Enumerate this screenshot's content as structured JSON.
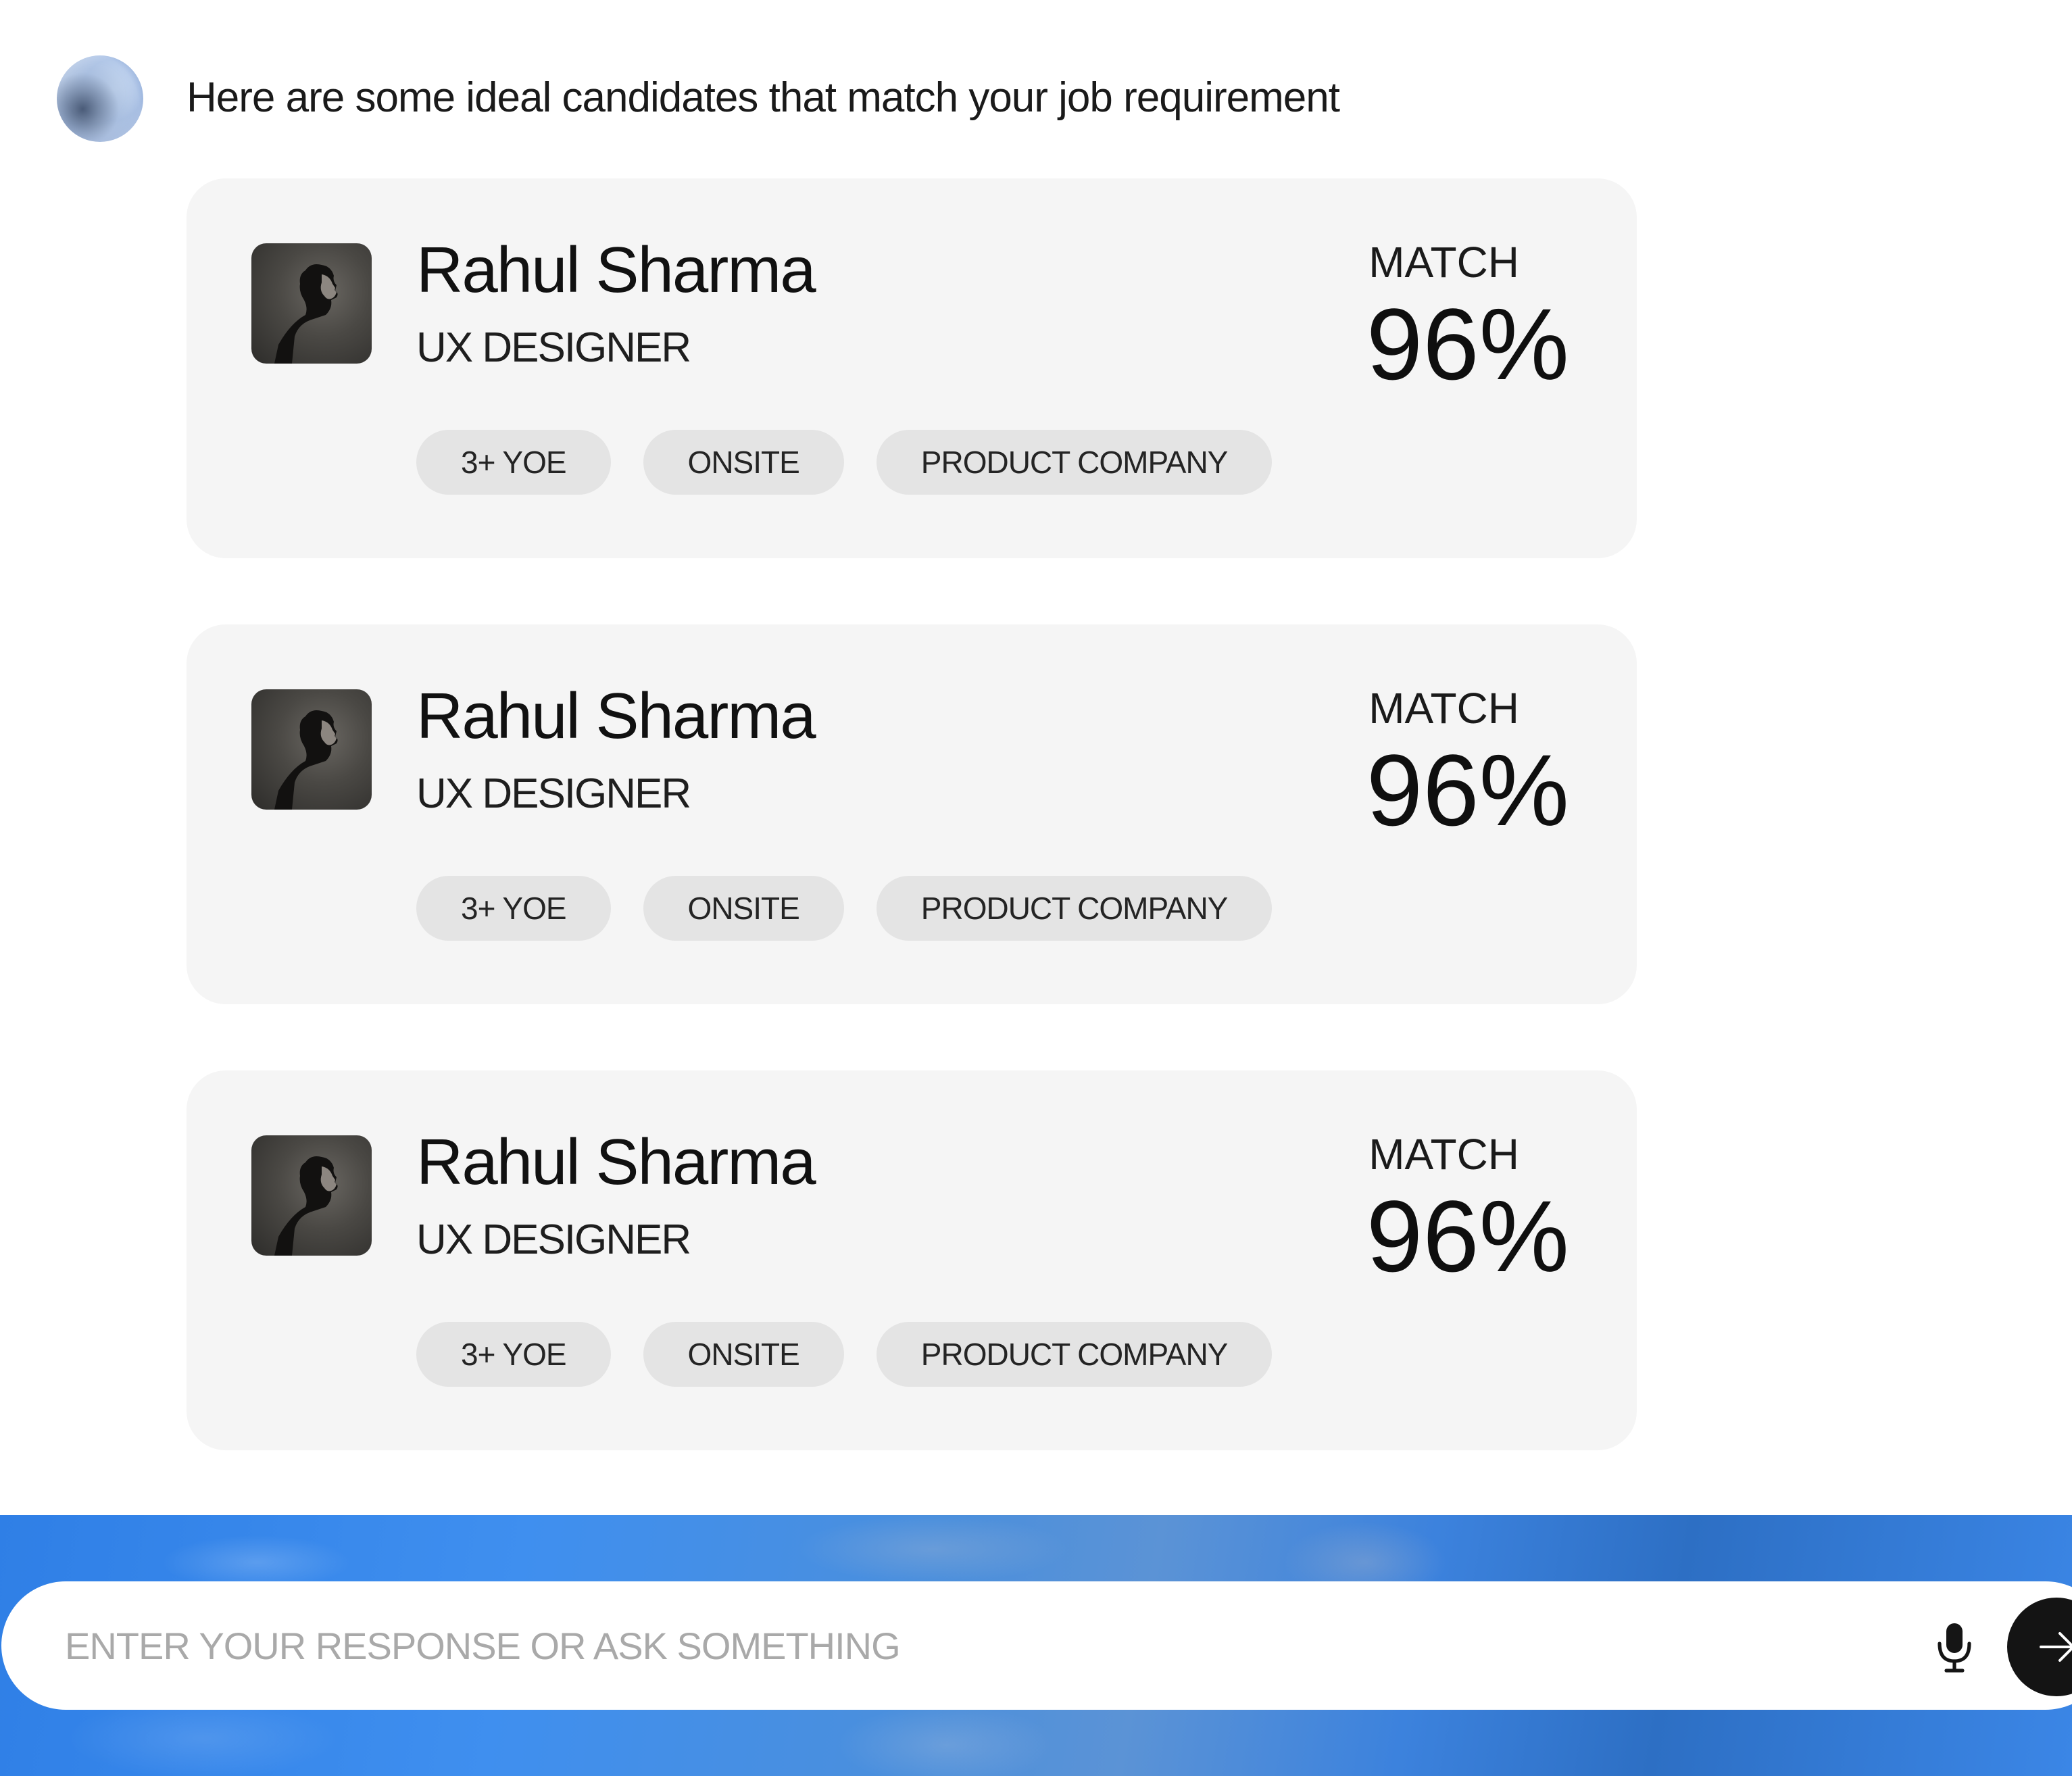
{
  "chat": {
    "intro": "Here are some ideal candidates that match your job requirement"
  },
  "candidates": [
    {
      "name": "Rahul Sharma",
      "role": "UX DESIGNER",
      "match_label": "MATCH",
      "match_value": "96%",
      "tags": [
        "3+ YOE",
        "ONSITE",
        "PRODUCT COMPANY"
      ]
    },
    {
      "name": "Rahul Sharma",
      "role": "UX DESIGNER",
      "match_label": "MATCH",
      "match_value": "96%",
      "tags": [
        "3+ YOE",
        "ONSITE",
        "PRODUCT COMPANY"
      ]
    },
    {
      "name": "Rahul Sharma",
      "role": "UX DESIGNER",
      "match_label": "MATCH",
      "match_value": "96%",
      "tags": [
        "3+ YOE",
        "ONSITE",
        "PRODUCT COMPANY"
      ]
    }
  ],
  "composer": {
    "placeholder": "ENTER YOUR RESPONSE OR ASK SOMETHING",
    "value": "",
    "mic_icon": "microphone-icon",
    "send_icon": "arrow-right-icon"
  },
  "colors": {
    "card_background": "#f5f5f5",
    "tag_background": "#e4e4e4",
    "send_button": "#141414",
    "backdrop_blue": "#3f8fef"
  }
}
